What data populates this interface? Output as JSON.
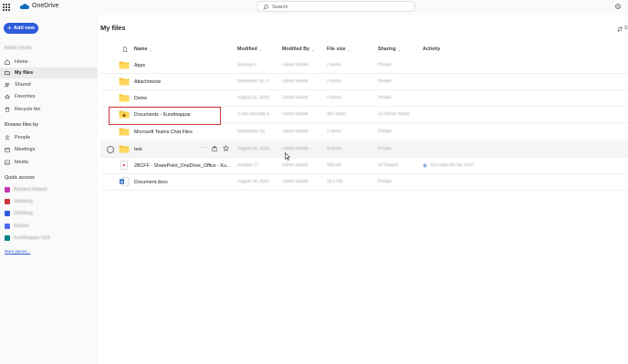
{
  "app": {
    "title": "OneDrive"
  },
  "search": {
    "placeholder": "Search"
  },
  "sidebar": {
    "add_new_label": "Add new",
    "user_name": "Admin Dewitt",
    "nav": [
      {
        "label": "Home",
        "icon": "home-icon"
      },
      {
        "label": "My files",
        "icon": "folder-icon",
        "selected": true
      },
      {
        "label": "Shared",
        "icon": "people-icon"
      },
      {
        "label": "Favorites",
        "icon": "star-icon"
      },
      {
        "label": "Recycle bin",
        "icon": "trash-icon"
      }
    ],
    "browse_heading": "Browse files by",
    "browse": [
      {
        "label": "People",
        "icon": "person-icon"
      },
      {
        "label": "Meetings",
        "icon": "calendar-icon"
      },
      {
        "label": "Media",
        "icon": "image-icon"
      }
    ],
    "quick_access_heading": "Quick access",
    "quick_access": [
      {
        "label": "Randers Marketi",
        "color": "#c239b3"
      },
      {
        "label": "Göteborg",
        "color": "#d13438"
      },
      {
        "label": "Göteborg",
        "color": "#2d5bdb"
      },
      {
        "label": "Marketi",
        "color": "#4f6bed"
      },
      {
        "label": "Kundmappar OLB",
        "color": "#038387"
      }
    ],
    "more_places": "More places..."
  },
  "main": {
    "title": "My files",
    "sort_label": "S",
    "columns": {
      "name": "Name",
      "modified": "Modified",
      "modified_by": "Modified By",
      "file_size": "File size",
      "sharing": "Sharing",
      "activity": "Activity"
    },
    "rows": [
      {
        "type": "folder",
        "name": "Apps",
        "modified": "January 4",
        "modified_by": "Admin Dewitt",
        "size": "1 items",
        "sharing": "Private",
        "activity": ""
      },
      {
        "type": "folder",
        "name": "Attachments",
        "modified": "November 16, 2",
        "modified_by": "Admin Dewitt",
        "size": "3 items",
        "sharing": "Private",
        "activity": ""
      },
      {
        "type": "folder",
        "name": "Demo",
        "modified": "August 11, 2022",
        "modified_by": "Admin Dewitt",
        "size": "0 items",
        "sharing": "Private",
        "activity": ""
      },
      {
        "type": "shared-folder",
        "name": "Documents - Kundmappar",
        "modified": "A few seconds a",
        "modified_by": "Admin Dewitt",
        "size": "387 items",
        "sharing": "13 Owner Readi",
        "activity": ""
      },
      {
        "type": "folder",
        "name": "Microsoft Teams Chat Files",
        "modified": "September 15",
        "modified_by": "Admin Dewitt",
        "size": "1 items",
        "sharing": "Private",
        "activity": ""
      },
      {
        "type": "folder",
        "name": "test",
        "modified": "August 19, 2022",
        "modified_by": "Admin Dewitt",
        "size": "3 items",
        "sharing": "Private",
        "activity": "",
        "hover": true
      },
      {
        "type": "video",
        "name": "2BCFF - SharePoint_OneDrive_Office - Ku...",
        "modified": "October 17",
        "modified_by": "Admin Dewitt",
        "size": "258 KB",
        "sharing": "18 Shared",
        "activity": "You have the file 10/17"
      },
      {
        "type": "word",
        "name": "Document.docx",
        "modified": "August 19, 2022",
        "modified_by": "Admin Dewitt",
        "size": "18.2 KB",
        "sharing": "Private",
        "activity": ""
      }
    ]
  },
  "colors": {
    "accent": "#2d5bdb",
    "folder": "#f4c33b",
    "highlight": "#d13438"
  }
}
